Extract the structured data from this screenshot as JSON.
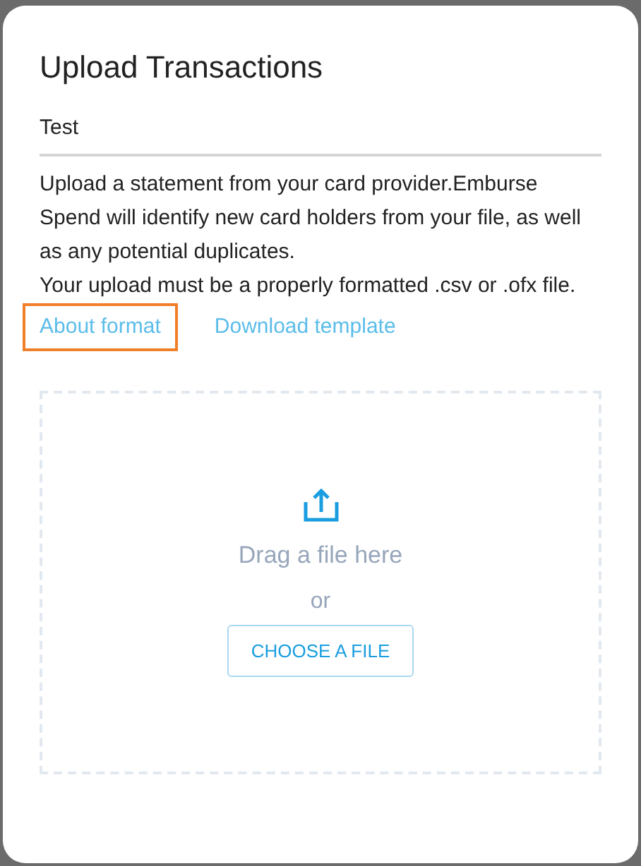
{
  "dialog": {
    "title": "Upload Transactions",
    "name_field": {
      "value": "Test"
    },
    "description": [
      "Upload a statement from your card provider.Emburse Spend will identify new card holders from your file, as well as any potential duplicates.",
      "Your upload must be a properly formatted .csv or .ofx file."
    ],
    "links": [
      {
        "label": "About format",
        "highlighted": true
      },
      {
        "label": "Download template",
        "highlighted": false
      }
    ],
    "drop_zone": {
      "prompt": "Drag a file here",
      "separator": "or",
      "button": "CHOOSE A FILE"
    }
  }
}
